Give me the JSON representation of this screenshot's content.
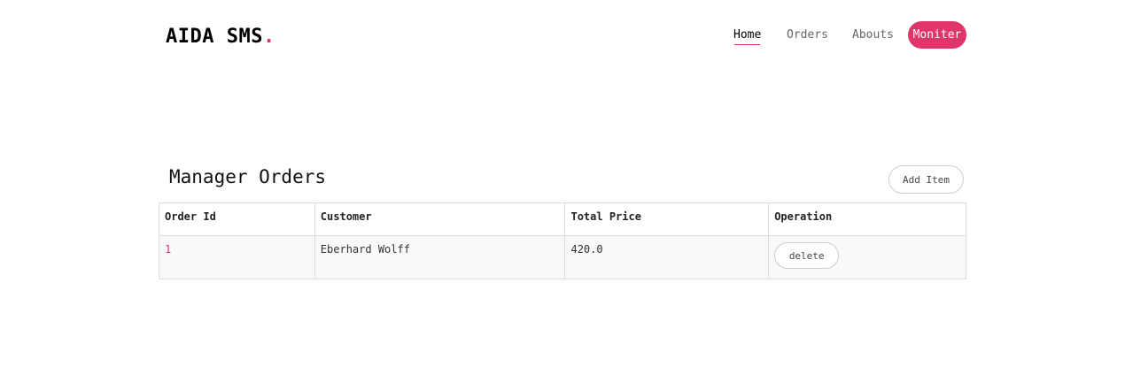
{
  "brand": {
    "name": "AIDA SMS",
    "dot": "."
  },
  "nav": {
    "home": "Home",
    "orders": "Orders",
    "abouts": "Abouts",
    "moniter": "Moniter"
  },
  "main": {
    "title": "Manager Orders",
    "add_label": "Add Item",
    "table": {
      "headers": [
        "Order Id",
        "Customer",
        "Total Price",
        "Operation"
      ],
      "rows": [
        {
          "id": "1",
          "customer": "Eberhard Wolff",
          "total": "420.0",
          "action": "delete"
        }
      ]
    }
  },
  "colors": {
    "accent": "#e0356b"
  }
}
